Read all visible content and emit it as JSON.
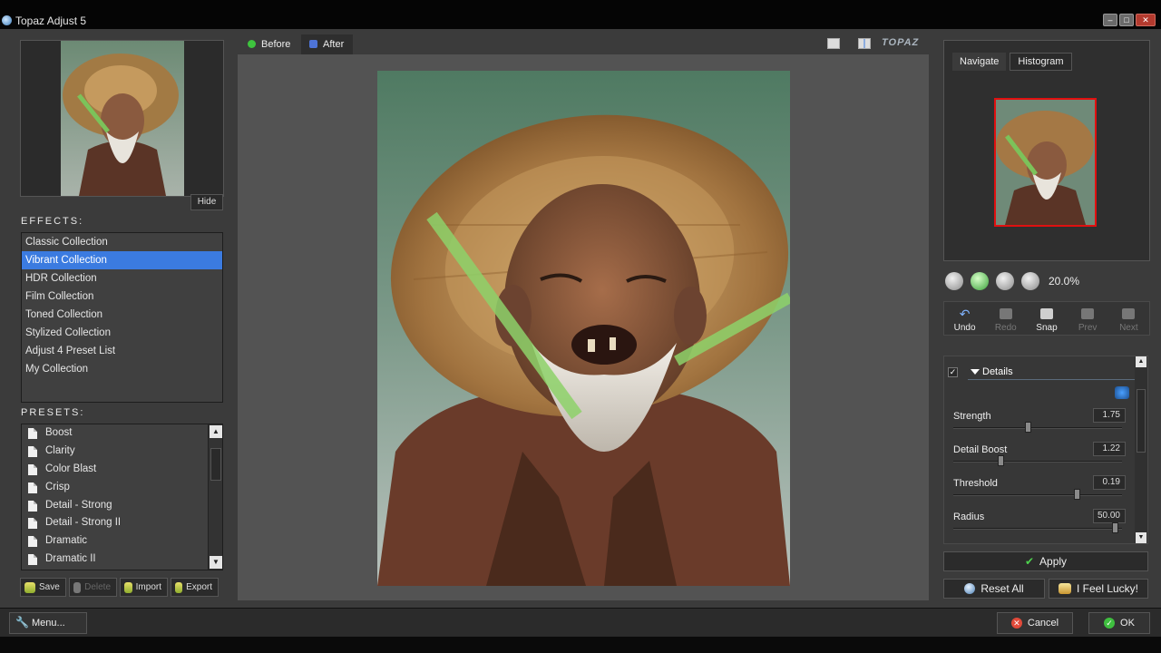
{
  "window": {
    "title": "Topaz Adjust 5",
    "controls": [
      "minimize",
      "maximize",
      "close"
    ]
  },
  "left": {
    "hide_label": "Hide",
    "effects_heading": "EFFECTS:",
    "effects": [
      {
        "label": "Classic Collection",
        "selected": false
      },
      {
        "label": "Vibrant Collection",
        "selected": true
      },
      {
        "label": "HDR Collection",
        "selected": false
      },
      {
        "label": "Film Collection",
        "selected": false
      },
      {
        "label": "Toned Collection",
        "selected": false
      },
      {
        "label": "Stylized Collection",
        "selected": false
      },
      {
        "label": "Adjust 4 Preset List",
        "selected": false
      },
      {
        "label": "My Collection",
        "selected": false
      }
    ],
    "presets_heading": "PRESETS:",
    "presets": [
      "Boost",
      "Clarity",
      "Color Blast",
      "Crisp",
      "Detail - Strong",
      "Detail - Strong II",
      "Dramatic",
      "Dramatic II"
    ],
    "preset_buttons": {
      "save": "Save",
      "delete": "Delete",
      "import": "Import",
      "export": "Export"
    }
  },
  "preview": {
    "tabs": {
      "before": "Before",
      "after": "After"
    },
    "logo_text": "TOPAZ"
  },
  "right": {
    "nav_tabs": {
      "navigate": "Navigate",
      "histogram": "Histogram"
    },
    "zoom_value": "20.0%",
    "history": {
      "undo": "Undo",
      "redo": "Redo",
      "snap": "Snap",
      "prev": "Prev",
      "next": "Next"
    },
    "details": {
      "title": "Details",
      "enabled": true,
      "sliders": [
        {
          "label": "Strength",
          "value": "1.75",
          "fraction": 0.44
        },
        {
          "label": "Detail Boost",
          "value": "1.22",
          "fraction": 0.27
        },
        {
          "label": "Threshold",
          "value": "0.19",
          "fraction": 0.74
        },
        {
          "label": "Radius",
          "value": "50.00",
          "fraction": 0.97
        }
      ]
    },
    "apply_label": "Apply",
    "reset_all_label": "Reset All",
    "lucky_label": "I Feel Lucky!"
  },
  "footer": {
    "menu_label": "Menu...",
    "cancel_label": "Cancel",
    "ok_label": "OK"
  },
  "colors": {
    "accent": "#3b7be0",
    "panel": "#3b3b3b",
    "preview_bg": "#535353",
    "nav_frame": "#e01010"
  }
}
